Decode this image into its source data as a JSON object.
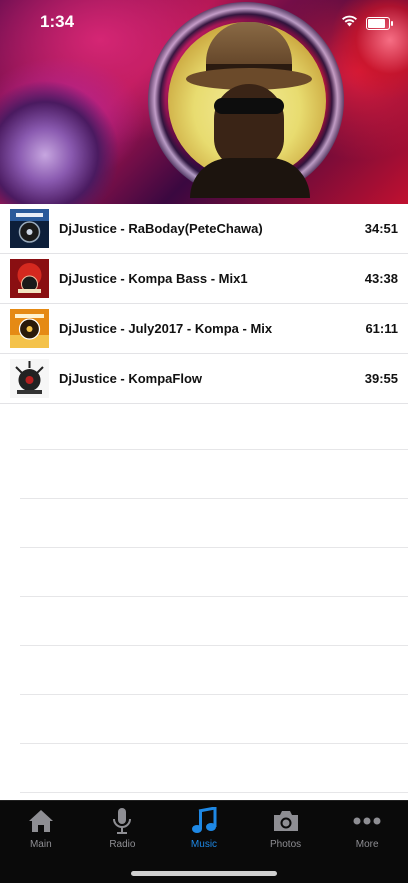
{
  "status_bar": {
    "time": "1:34",
    "battery_level": 0.9,
    "icons": [
      "wifi-icon",
      "battery-icon"
    ]
  },
  "banner": {
    "image": "dj-portrait-headphones"
  },
  "tracks": [
    {
      "title": "DjJustice - RaBoday(PeteChawa)",
      "duration": "34:51",
      "thumb_color": "#1c3a66"
    },
    {
      "title": "DjJustice - Kompa Bass - Mix1",
      "duration": "43:38",
      "thumb_color": "#b01818"
    },
    {
      "title": "DjJustice - July2017 - Kompa - Mix",
      "duration": "61:11",
      "thumb_color": "#e07a10"
    },
    {
      "title": "DjJustice - KompaFlow",
      "duration": "39:55",
      "thumb_color": "#f2f2f2"
    }
  ],
  "tab_bar": {
    "active_color": "#1e88e5",
    "inactive_color": "#8e8e93",
    "tabs": [
      {
        "label": "Main",
        "icon": "home-icon",
        "active": false
      },
      {
        "label": "Radio",
        "icon": "microphone-icon",
        "active": false
      },
      {
        "label": "Music",
        "icon": "music-note-icon",
        "active": true
      },
      {
        "label": "Photos",
        "icon": "camera-icon",
        "active": false
      },
      {
        "label": "More",
        "icon": "more-dots-icon",
        "active": false
      }
    ]
  }
}
